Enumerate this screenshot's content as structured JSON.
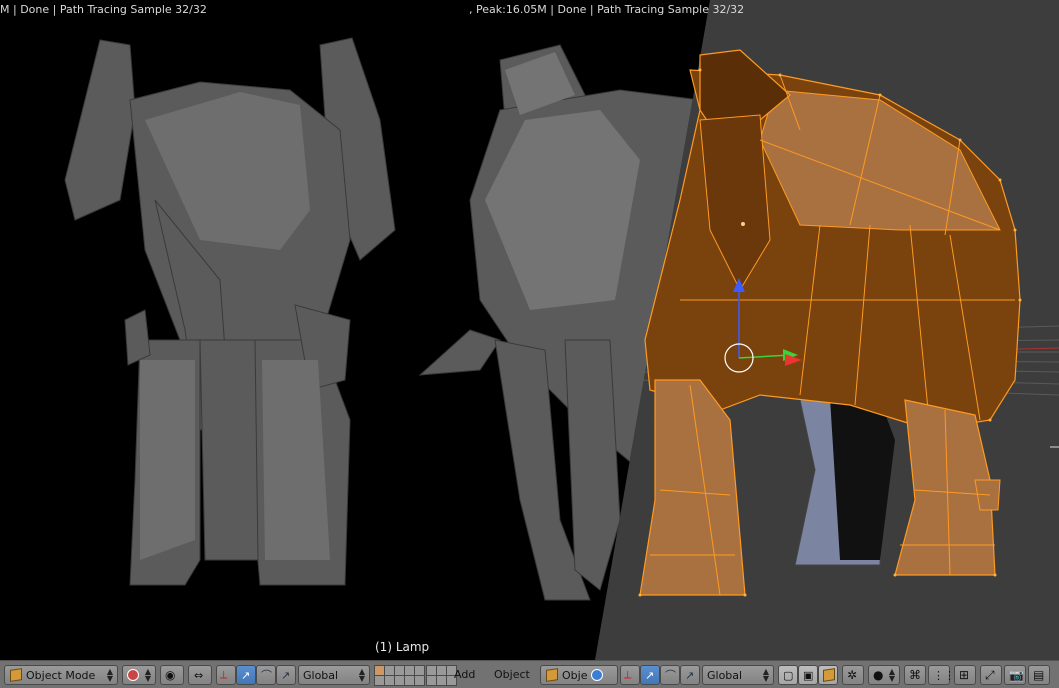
{
  "viewport": {
    "status_left": "M | Done | Path Tracing Sample 32/32",
    "status_mid": ", Peak:16.05M | Done | Path Tracing Sample 32/32",
    "object_label": "(1) Lamp"
  },
  "header": {
    "mode": {
      "label": "Object Mode",
      "icon": "cube-icon"
    },
    "viewport_shading": {
      "icon": "sphere-shading-icon"
    },
    "pivot": {
      "icon": "pivot-point-icon"
    },
    "manipulators": [
      "translate-icon",
      "rotate-icon",
      "scale-icon"
    ],
    "orientation": {
      "label": "Global"
    },
    "add_menu": "Add",
    "object_menu": "Object",
    "mode2": {
      "label": "Obje",
      "icon": "cube-icon"
    },
    "orientation2": {
      "label": "Global"
    },
    "right_icons": [
      "render-layers-icon",
      "snap-icon",
      "proportional-icon",
      "onion-icon",
      "render-icon",
      "camera-icon"
    ]
  },
  "colors": {
    "header_bg": "#727272",
    "viewport_bg": "#3d3d3d",
    "render_bg": "#000000",
    "mesh_fill": "#8a4a10",
    "mesh_wire": "#ff9a22",
    "active_button": "#5a8fd0"
  }
}
